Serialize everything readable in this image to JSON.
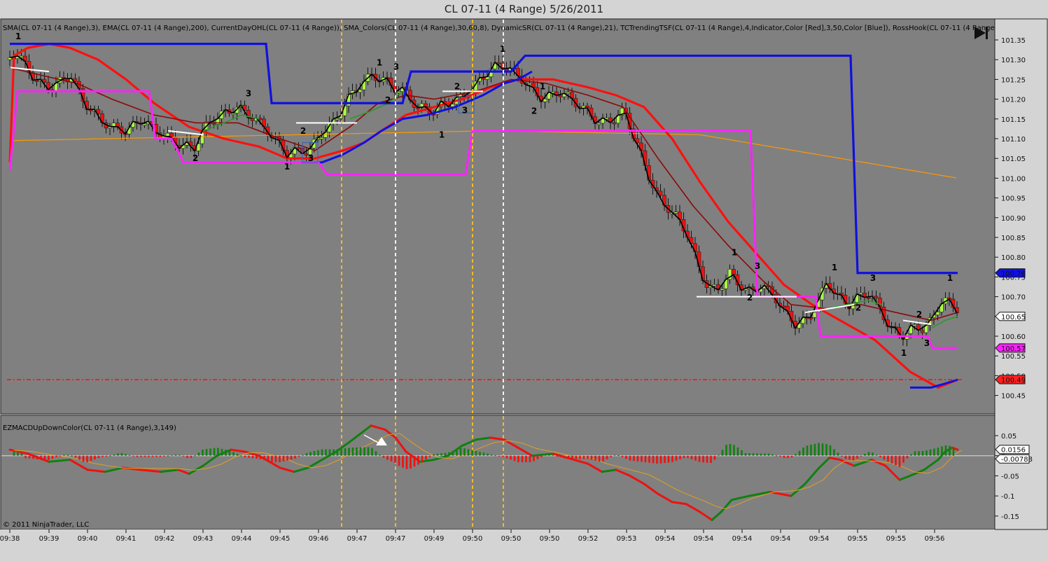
{
  "window": {
    "title": "CL 07-11 (4 Range)  5/26/2011"
  },
  "price_panel": {
    "indicator_label": "SMA(CL 07-11 (4 Range),3), EMA(CL 07-11 (4 Range),200), CurrentDayOHL(CL 07-11 (4 Range)), SMA_Colors(CL 07-11 (4 Range),30,60,8), DynamicSR(CL 07-11 (4 Range),21), TCTrendingTSF(CL 07-11 (4 Range),4,Indicator,Color [Red],3,50,Color [Blue]), RossHook(CL 07-11 (4 Range",
    "y_ticks": [
      "101.35",
      "101.30",
      "101.25",
      "101.20",
      "101.15",
      "101.10",
      "101.05",
      "101.00",
      "100.95",
      "100.90",
      "100.85",
      "100.80",
      "100.75",
      "100.70",
      "100.65",
      "100.60",
      "100.55",
      "100.50",
      "100.45"
    ],
    "price_tags": [
      {
        "text": "100.76",
        "color": "#1010e0"
      },
      {
        "text": "100.65",
        "color": "#ffffff"
      },
      {
        "text": "100.57",
        "color": "#ff20ff"
      },
      {
        "text": "100.49",
        "color": "#ff2020"
      }
    ],
    "ross_hook_labels": [
      {
        "text": "1",
        "x": 26,
        "price": 101.352
      },
      {
        "text": "2",
        "x": 279,
        "price": 101.043
      },
      {
        "text": "3",
        "x": 355,
        "price": 101.207
      },
      {
        "text": "2",
        "x": 433,
        "price": 101.112
      },
      {
        "text": "1",
        "x": 410,
        "price": 101.022
      },
      {
        "text": "3",
        "x": 444,
        "price": 101.043
      },
      {
        "text": "1",
        "x": 542,
        "price": 101.285
      },
      {
        "text": "3",
        "x": 566,
        "price": 101.275
      },
      {
        "text": "2",
        "x": 554,
        "price": 101.19
      },
      {
        "text": "2",
        "x": 653,
        "price": 101.225
      },
      {
        "text": "3",
        "x": 664,
        "price": 101.165
      },
      {
        "text": "1",
        "x": 631,
        "price": 101.103
      },
      {
        "text": "1",
        "x": 718,
        "price": 101.32
      },
      {
        "text": "1",
        "x": 775,
        "price": 101.225
      },
      {
        "text": "2",
        "x": 763,
        "price": 101.163
      },
      {
        "text": "1",
        "x": 1049,
        "price": 100.805
      },
      {
        "text": "3",
        "x": 1082,
        "price": 100.77
      },
      {
        "text": "2",
        "x": 1071,
        "price": 100.69
      },
      {
        "text": "1",
        "x": 1192,
        "price": 100.767
      },
      {
        "text": "3",
        "x": 1247,
        "price": 100.74
      },
      {
        "text": "2",
        "x": 1226,
        "price": 100.665
      },
      {
        "text": "2",
        "x": 1313,
        "price": 100.648
      },
      {
        "text": "1",
        "x": 1291,
        "price": 100.55
      },
      {
        "text": "3",
        "x": 1324,
        "price": 100.575
      },
      {
        "text": "1",
        "x": 1357,
        "price": 100.74
      }
    ]
  },
  "osc_panel": {
    "indicator_label": "EZMACDUpDownColor(CL 07-11 (4 Range),3,149)",
    "y_ticks": [
      "0.05",
      "0",
      "-0.05",
      "-0.1",
      "-0.15"
    ],
    "value_tags": [
      {
        "text": "0.0156",
        "color": "#ffffff"
      },
      {
        "text": "-0.00788",
        "color": "#ffffff"
      }
    ]
  },
  "x_ticks": [
    "09:38",
    "09:39",
    "09:40",
    "09:41",
    "09:42",
    "09:43",
    "09:44",
    "09:45",
    "09:46",
    "09:47",
    "09:47",
    "09:49",
    "09:50",
    "09:50",
    "09:50",
    "09:52",
    "09:53",
    "09:54",
    "09:54",
    "09:54",
    "09:54",
    "09:54",
    "09:55",
    "09:55",
    "09:56"
  ],
  "copyright": "© 2011 NinjaTrader, LLC",
  "colors": {
    "background": "#808080",
    "up_candle": "#aaff44",
    "down_candle": "#ee1111",
    "resistance": "#1010e0",
    "support": "#ff22ff",
    "ema200": "#ff9900",
    "trend": "#ff1010",
    "osc_up": "#108010",
    "osc_down": "#ee1111"
  },
  "chart_data": [
    {
      "type": "candlestick",
      "title": "CL 07-11 (4 Range)  5/26/2011",
      "ylim": [
        100.42,
        101.37
      ],
      "x_labels": [
        "09:38",
        "09:39",
        "09:40",
        "09:41",
        "09:42",
        "09:43",
        "09:44",
        "09:45",
        "09:46",
        "09:47",
        "09:47",
        "09:49",
        "09:50",
        "09:50",
        "09:50",
        "09:52",
        "09:53",
        "09:54",
        "09:54",
        "09:54",
        "09:54",
        "09:54",
        "09:55",
        "09:55",
        "09:56"
      ],
      "reference_lines": {
        "high_of_day": [
          101.34,
          101.19,
          101.27,
          101.31,
          100.76
        ],
        "low_of_day": [
          101.22,
          101.04,
          101.01,
          101.12,
          100.7,
          100.6,
          100.57
        ],
        "dashed_level": 100.49
      }
    },
    {
      "type": "bar",
      "title": "EZMACDUpDownColor(CL 07-11 (4 Range),3,149)",
      "ylim": [
        -0.17,
        0.08
      ],
      "last_values": [
        0.0156,
        -0.00788
      ]
    }
  ]
}
